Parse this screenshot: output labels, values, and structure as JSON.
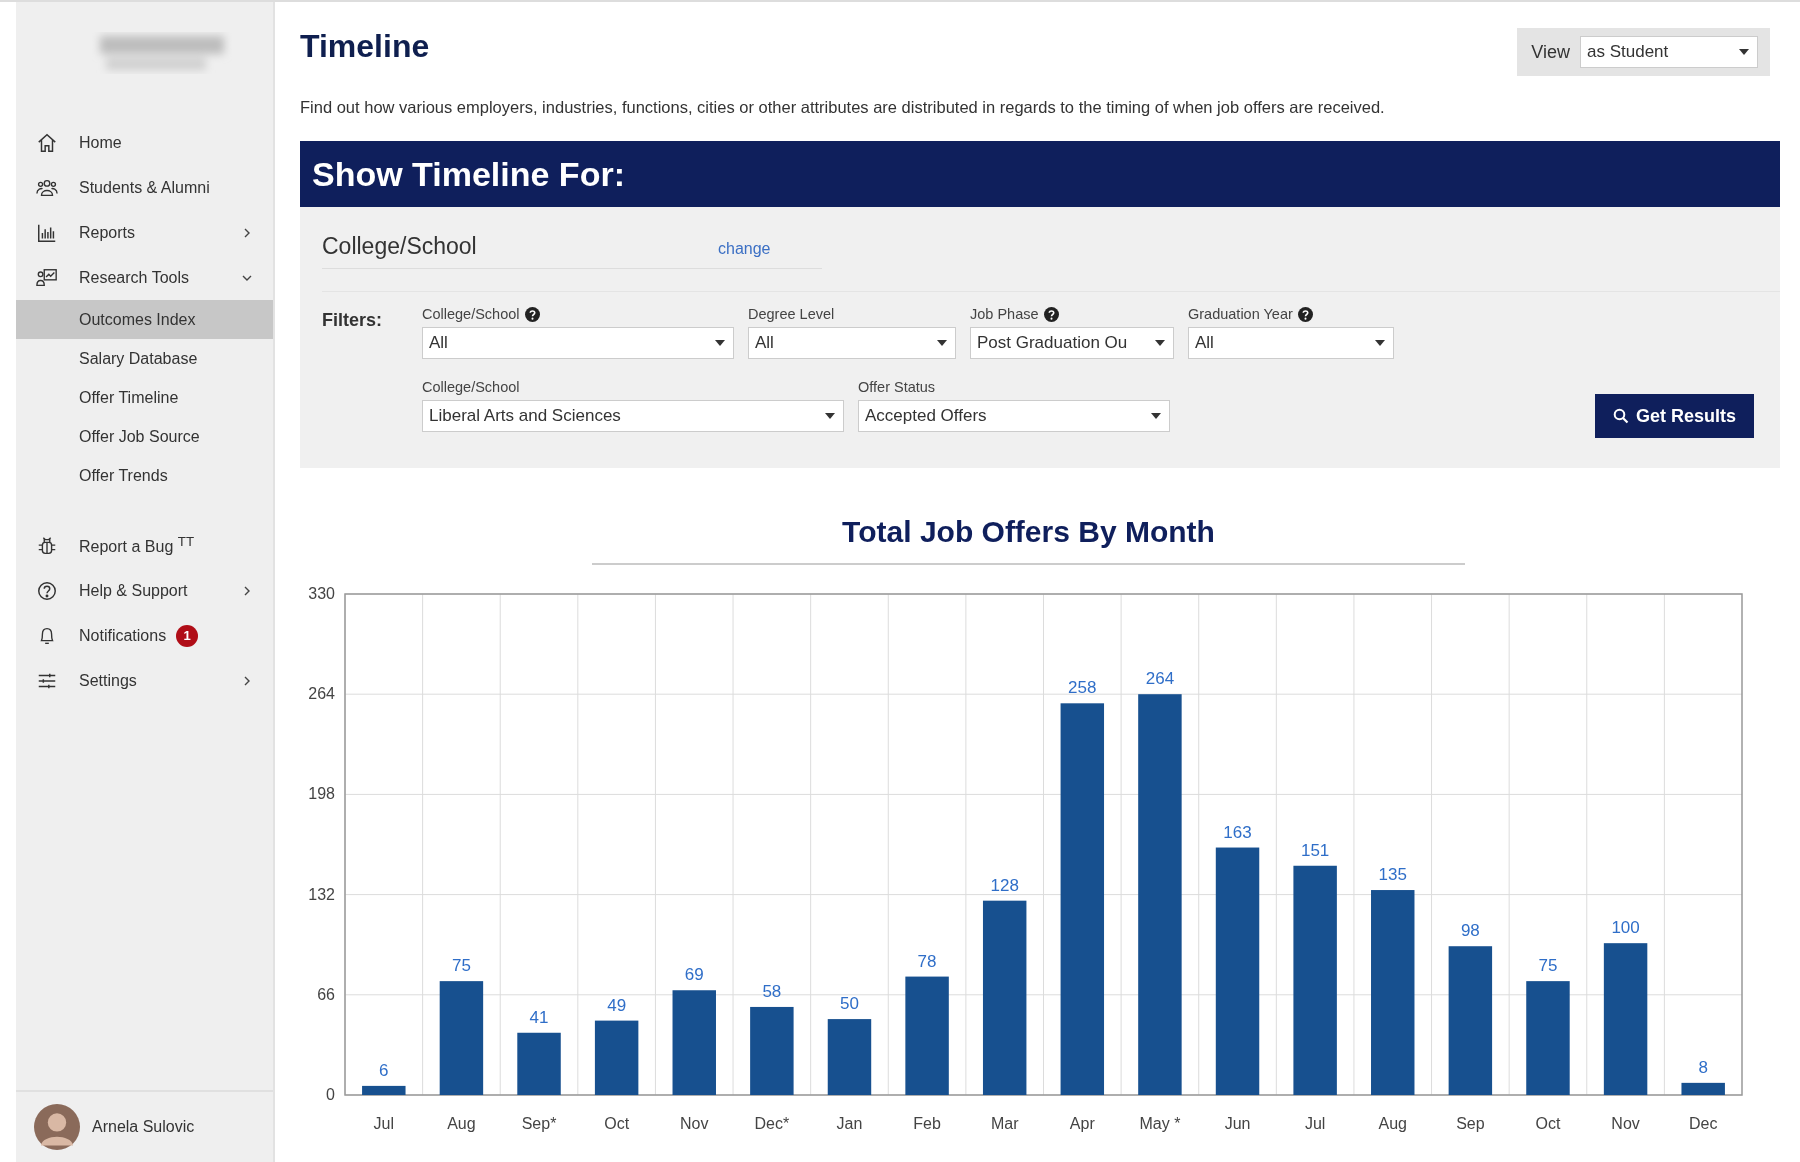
{
  "sidebar": {
    "nav": [
      {
        "label": "Home"
      },
      {
        "label": "Students & Alumni"
      },
      {
        "label": "Reports",
        "expanded": false
      },
      {
        "label": "Research Tools",
        "expanded": true,
        "children": [
          {
            "label": "Outcomes Index",
            "selected": true
          },
          {
            "label": "Salary Database",
            "selected": false
          },
          {
            "label": "Offer Timeline",
            "selected": false
          },
          {
            "label": "Offer Job Source",
            "selected": false
          },
          {
            "label": "Offer Trends",
            "selected": false
          }
        ]
      }
    ],
    "secondary": [
      {
        "label": "Report a Bug $^{TT}$"
      },
      {
        "label": "Help & Support",
        "expanded": false
      },
      {
        "label": "Notifications",
        "badge": "1"
      },
      {
        "label": "Settings",
        "expanded": false
      }
    ],
    "user": {
      "name": "Arnela Sulovic"
    }
  },
  "page": {
    "title": "Timeline",
    "view": {
      "label": "View",
      "value": "as Student"
    },
    "description": "Find out how various employers, industries, functions, cities or other attributes are distributed in regards to the timing of when job offers are received.",
    "banner": "Show Timeline For:",
    "selection": {
      "label": "College/School",
      "link": "change"
    },
    "filters": {
      "label": "Filters:",
      "rows": [
        [
          {
            "label": "College/School",
            "value": "All",
            "help": true
          },
          {
            "label": "Degree Level",
            "value": "All",
            "help": false
          },
          {
            "label": "Job Phase",
            "value": "Post Graduation Ou",
            "help": true
          },
          {
            "label": "Graduation Year",
            "value": "All",
            "help": true
          }
        ],
        [
          {
            "label": "College/School",
            "value": "Liberal Arts and Sciences",
            "help": false
          },
          {
            "label": "Offer Status",
            "value": "Accepted Offers",
            "help": false
          }
        ]
      ]
    },
    "button": "Get Results",
    "chart_data": {
      "type": "bar",
      "title": "Total Job Offers By Month",
      "categories": [
        "Jul",
        "Aug",
        "Sep*",
        "Oct",
        "Nov",
        "Dec*",
        "Jan",
        "Feb",
        "Mar",
        "Apr",
        "May *",
        "Jun",
        "Jul",
        "Aug",
        "Sep",
        "Oct",
        "Nov",
        "Dec"
      ],
      "series": [
        {
          "color": "#17508f",
          "values": [
            6,
            75,
            41,
            49,
            69,
            58,
            50,
            78,
            128,
            258,
            264,
            163,
            151,
            135,
            98,
            75,
            100,
            8
          ]
        }
      ],
      "ylim": [
        0,
        330
      ],
      "yticks": [
        0,
        66,
        132,
        198,
        264,
        330
      ],
      "data_labels": true,
      "grid": true
    }
  }
}
